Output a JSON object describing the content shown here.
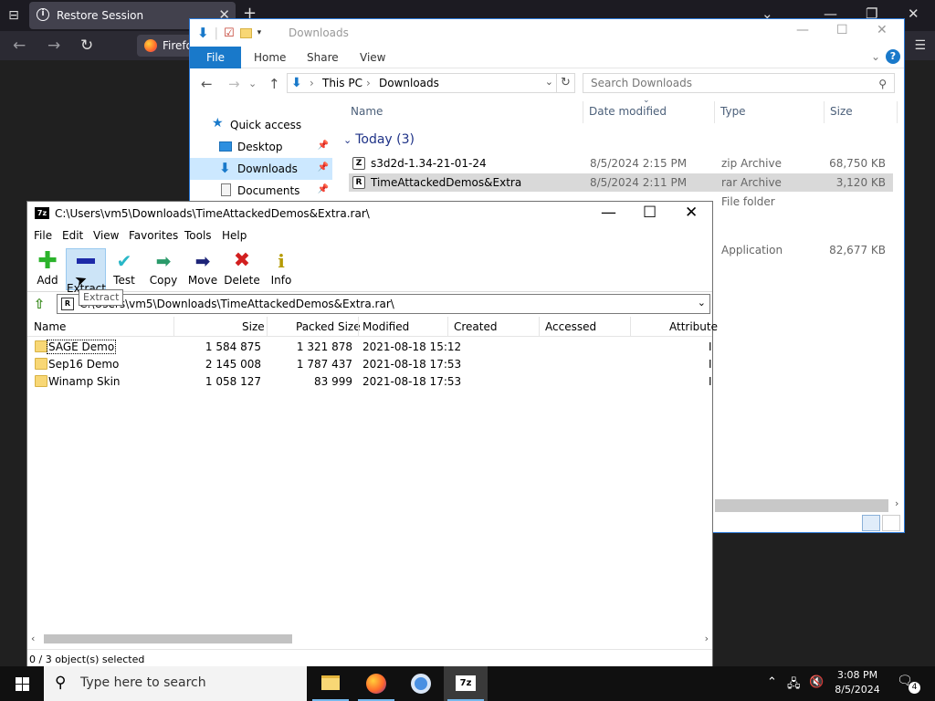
{
  "firefox": {
    "tab_title": "Restore Session",
    "tab_close": "✕",
    "new_tab": "+",
    "button_text": "Firefox"
  },
  "explorer": {
    "title": "Downloads",
    "ribbon": {
      "file": "File",
      "home": "Home",
      "share": "Share",
      "view": "View"
    },
    "breadcrumb": {
      "root": "This PC",
      "current": "Downloads"
    },
    "search_placeholder": "Search Downloads",
    "sidebar": [
      {
        "label": "Quick access"
      },
      {
        "label": "Desktop"
      },
      {
        "label": "Downloads"
      },
      {
        "label": "Documents"
      }
    ],
    "columns": {
      "name": "Name",
      "date": "Date modified",
      "type": "Type",
      "size": "Size"
    },
    "group_header": "Today (3)",
    "files": [
      {
        "name": "s3d2d-1.34-21-01-24",
        "date": "8/5/2024 2:15 PM",
        "type": "zip Archive",
        "size": "68,750 KB",
        "icon": "Z"
      },
      {
        "name": "TimeAttackedDemos&Extra",
        "date": "8/5/2024 2:11 PM",
        "type": "rar Archive",
        "size": "3,120 KB",
        "icon": "R"
      },
      {
        "name": "",
        "date": "",
        "type": "File folder",
        "size": ""
      },
      {
        "name": "",
        "date": "",
        "type": "Application",
        "size": "82,677 KB"
      }
    ]
  },
  "sevenzip": {
    "title": "C:\\Users\\vm5\\Downloads\\TimeAttackedDemos&Extra.rar\\",
    "logo": "7z",
    "menu": [
      "File",
      "Edit",
      "View",
      "Favorites",
      "Tools",
      "Help"
    ],
    "toolbar": [
      {
        "label": "Add",
        "icon": "add-icon"
      },
      {
        "label": "Extract",
        "icon": "extract-icon"
      },
      {
        "label": "Test",
        "icon": "test-icon"
      },
      {
        "label": "Copy",
        "icon": "copy-icon"
      },
      {
        "label": "Move",
        "icon": "move-icon"
      },
      {
        "label": "Delete",
        "icon": "delete-icon"
      },
      {
        "label": "Info",
        "icon": "info-icon"
      }
    ],
    "tooltip": "Extract",
    "path": "C:\\Users\\vm5\\Downloads\\TimeAttackedDemos&Extra.rar\\",
    "columns": [
      "Name",
      "Size",
      "Packed Size",
      "Modified",
      "Created",
      "Accessed",
      "Attribute"
    ],
    "rows": [
      {
        "name": "SAGE Demo",
        "size": "1 584 875",
        "packed": "1 321 878",
        "modified": "2021-08-18 15:12",
        "attr": "I"
      },
      {
        "name": "Sep16 Demo",
        "size": "2 145 008",
        "packed": "1 787 437",
        "modified": "2021-08-18 17:53",
        "attr": "I"
      },
      {
        "name": "Winamp Skin",
        "size": "1 058 127",
        "packed": "83 999",
        "modified": "2021-08-18 17:53",
        "attr": "I"
      }
    ],
    "status": "0 / 3 object(s) selected"
  },
  "taskbar": {
    "search_placeholder": "Type here to search",
    "time": "3:08 PM",
    "date": "8/5/2024",
    "notification_count": "4",
    "zip_app_label": "7z"
  },
  "colors": {
    "accent": "#1979ca",
    "selection": "#cce8ff",
    "folder": "#f8d775"
  }
}
